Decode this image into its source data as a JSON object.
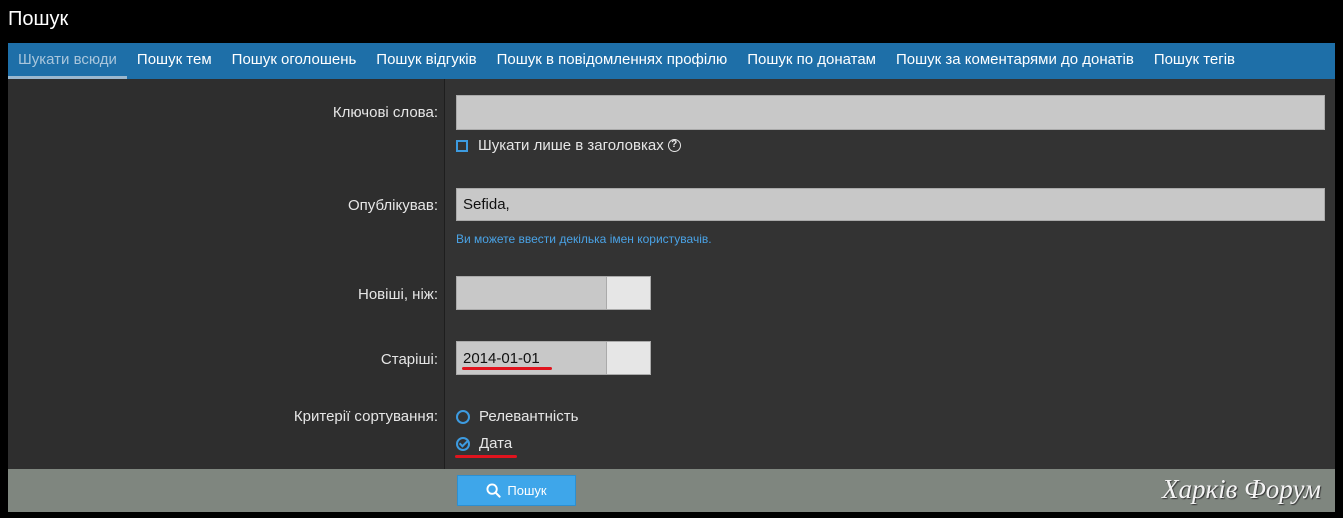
{
  "page": {
    "title": "Пошук"
  },
  "tabs": [
    {
      "label": "Шукати всюди",
      "active": true
    },
    {
      "label": "Пошук тем"
    },
    {
      "label": "Пошук оголошень"
    },
    {
      "label": "Пошук відгуків"
    },
    {
      "label": "Пошук в повідомленнях профілю"
    },
    {
      "label": "Пошук по донатам"
    },
    {
      "label": "Пошук за коментарями до донатів"
    },
    {
      "label": "Пошук тегів"
    }
  ],
  "form": {
    "keywords": {
      "label": "Ключові слова:",
      "value": ""
    },
    "titles_only": {
      "label": "Шукати лише в заголовках",
      "checked": false,
      "icon": "help-icon"
    },
    "posted_by": {
      "label": "Опублікував:",
      "value": "Sefida,",
      "hint": "Ви можете ввести декілька імен користувачів."
    },
    "newer_than": {
      "label": "Новіші, ніж:",
      "value": ""
    },
    "older_than": {
      "label": "Старіші:",
      "value": "2014-01-01"
    },
    "sort": {
      "label": "Критерії сортування:",
      "options": [
        {
          "label": "Релевантність",
          "checked": false
        },
        {
          "label": "Дата",
          "checked": true
        }
      ]
    }
  },
  "footer": {
    "search_label": "Пошук",
    "search_icon": "search-icon",
    "watermark": "Харків Форум"
  },
  "colors": {
    "accent": "#1e6fa8",
    "button": "#3ea6ea",
    "highlight": "#e0141e"
  }
}
